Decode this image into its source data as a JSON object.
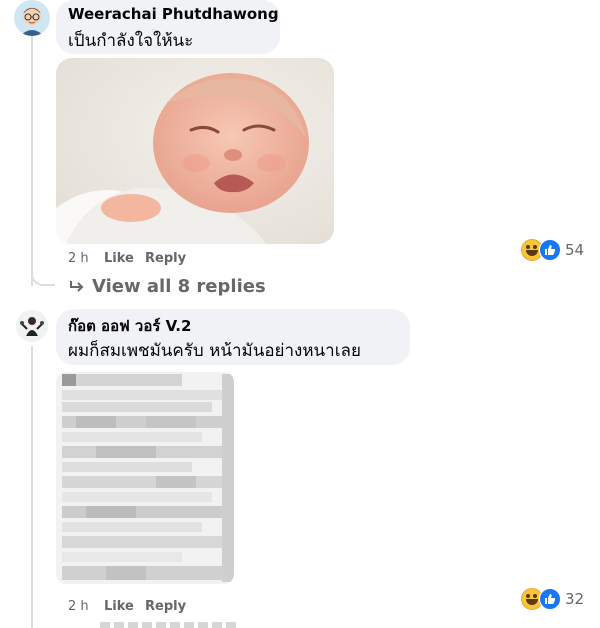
{
  "comments": [
    {
      "author": "Weerachai Phutdhawong",
      "text": "เป็นกำลังใจให้นะ",
      "time": "2 h",
      "like_label": "Like",
      "reply_label": "Reply",
      "reaction_count": "54",
      "reaction_icons": [
        "haha-icon",
        "like-icon"
      ],
      "attachment": "photo of a crying baby"
    },
    {
      "author": "ก๊อต ออฟ วอร์ V.2",
      "text": "ผมก็สมเพชมันครับ หน้ามันอย่างหนาเลย",
      "time": "2 h",
      "like_label": "Like",
      "reply_label": "Reply",
      "reaction_count": "32",
      "reaction_icons": [
        "haha-icon",
        "like-icon"
      ],
      "attachment": "pixelated screenshot"
    }
  ],
  "view_replies_label": "View all 8 replies",
  "colors": {
    "bubble": "#f0f2f5",
    "meta_text": "#65676b",
    "like_blue": "#1877f2",
    "haha_yellow": "#f7c43d"
  }
}
